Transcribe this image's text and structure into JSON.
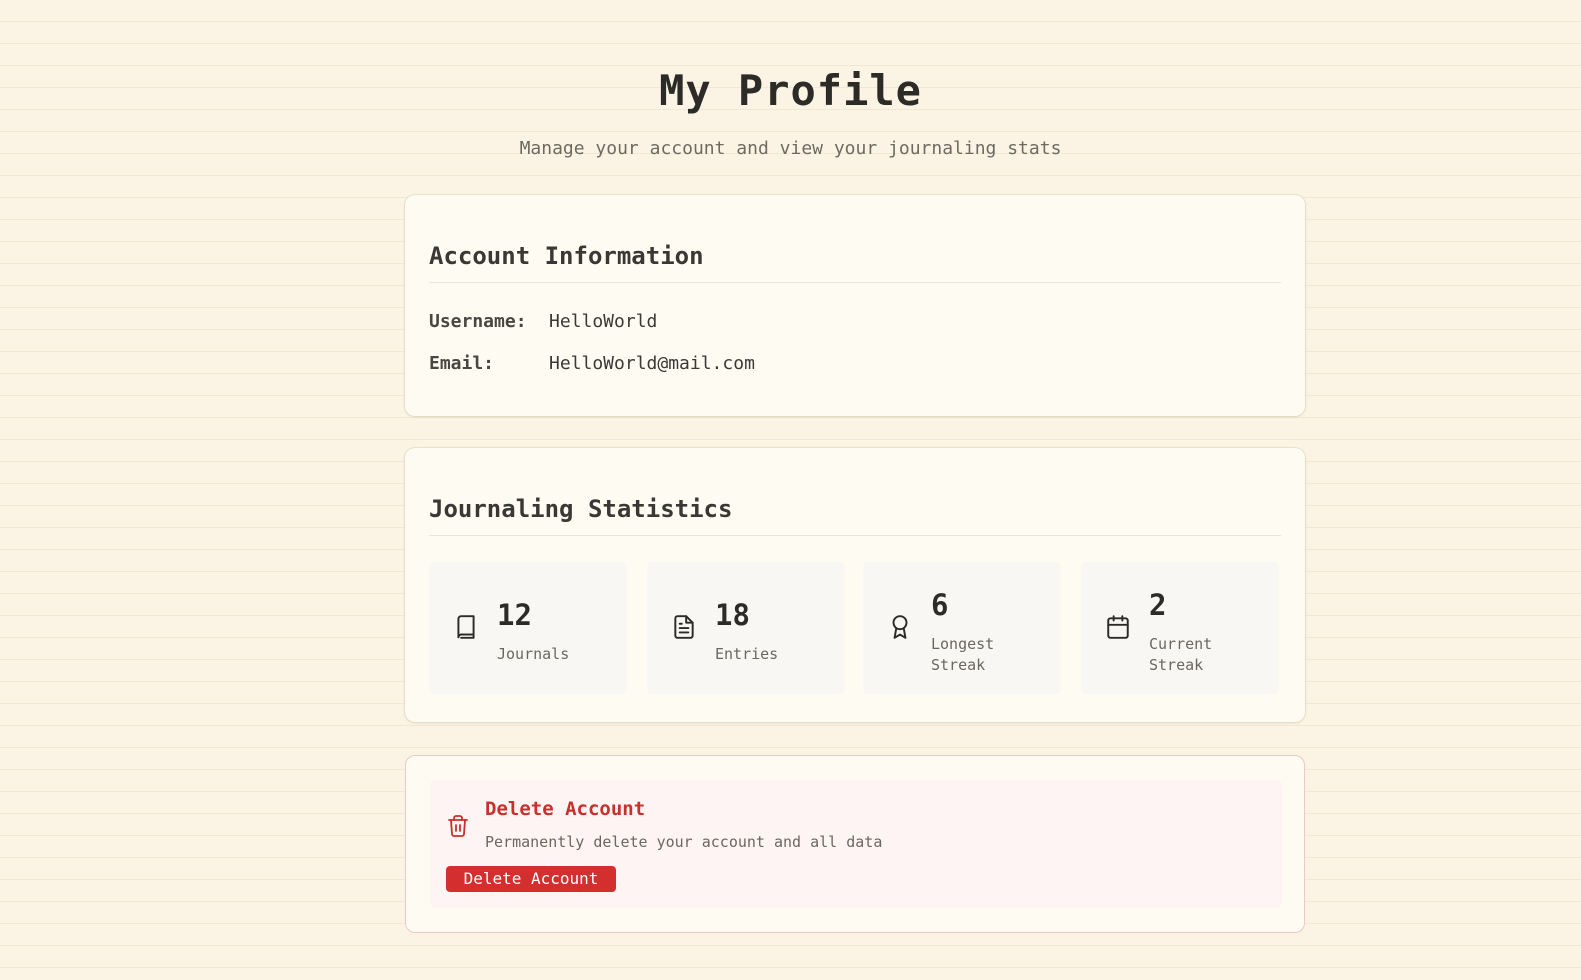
{
  "header": {
    "title": "My Profile",
    "subtitle": "Manage your account and view your journaling stats"
  },
  "account": {
    "heading": "Account Information",
    "username_label": "Username:",
    "username_value": "HelloWorld",
    "email_label": "Email:",
    "email_value": "HelloWorld@mail.com"
  },
  "stats": {
    "heading": "Journaling Statistics",
    "items": [
      {
        "icon": "book-icon",
        "value": "12",
        "label": "Journals"
      },
      {
        "icon": "document-icon",
        "value": "18",
        "label": "Entries"
      },
      {
        "icon": "award-icon",
        "value": "6",
        "label": "Longest Streak"
      },
      {
        "icon": "calendar-icon",
        "value": "2",
        "label": "Current Streak"
      }
    ]
  },
  "danger": {
    "icon": "trash-icon",
    "title": "Delete Account",
    "description": "Permanently delete your account and all data",
    "button_label": "Delete Account",
    "accent_color": "#d32f2f"
  }
}
